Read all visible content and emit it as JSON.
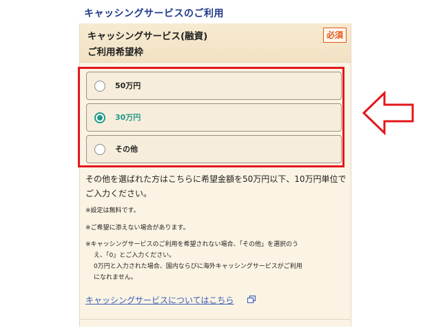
{
  "section_title": "キャッシングサービスのご利用",
  "field": {
    "title_line1": "キャッシングサービス(融資)",
    "title_line2": "ご利用希望枠",
    "required_badge": "必須"
  },
  "options": [
    {
      "label": "50万円",
      "checked": false
    },
    {
      "label": "30万円",
      "checked": true
    },
    {
      "label": "その他",
      "checked": false
    }
  ],
  "description": "その他を選ばれた方はこちらに希望金額を50万円以下、10万円単位でご入力ください。",
  "notes": {
    "note1": "※設定は無料です。",
    "note2": "※ご希望に添えない場合があります。",
    "note3_line1": "※キャッシングサービスのご利用を希望されない場合、「その他」を選択のう",
    "note3_line2": "え、「0」とご入力ください。",
    "note3_line3": "0万円と入力された場合、国内ならびに海外キャッシングサービスがご利用",
    "note3_line4": "になれません。"
  },
  "link_text": "キャッシングサービスについてはこちら",
  "colors": {
    "accent": "#1c9a86",
    "highlight_frame": "#e4151b",
    "title": "#1f3a8a",
    "link": "#3a5db8",
    "required": "#e05a1c"
  }
}
